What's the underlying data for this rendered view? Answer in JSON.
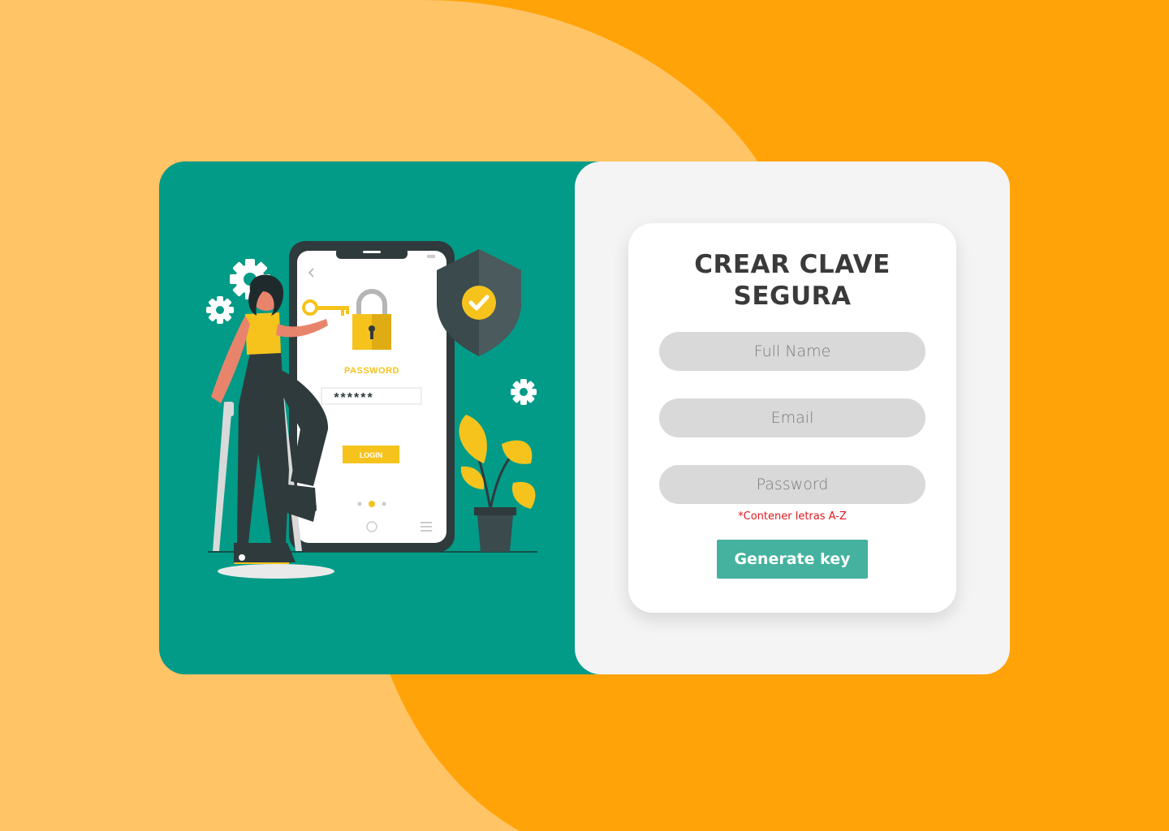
{
  "colors": {
    "background": "#ffa308",
    "background_blob": "#ffc466",
    "panel_teal": "#019b87",
    "form_panel": "#f4f4f4",
    "button": "#44b29e",
    "hint": "#e0181e",
    "yellow": "#f6c31d"
  },
  "illustration": {
    "phone": {
      "password_label": "PASSWORD",
      "masked_value": "******",
      "login_label": "LOGIN"
    },
    "icons": [
      "gear-icon",
      "shield-check-icon",
      "padlock-icon",
      "key-icon",
      "plant-icon"
    ]
  },
  "form": {
    "title_line1": "CREAR CLAVE",
    "title_line2": "SEGURA",
    "full_name_placeholder": "Full Name",
    "email_placeholder": "Email",
    "password_placeholder": "Password",
    "password_hint": "*Contener letras A-Z",
    "submit_label": "Generate key"
  }
}
